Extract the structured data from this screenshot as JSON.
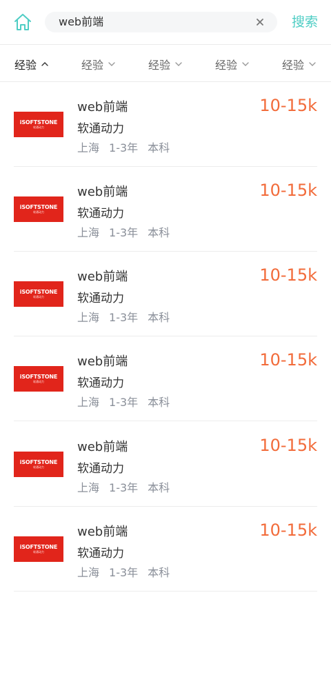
{
  "header": {
    "search_value": "web前端",
    "search_button": "搜索"
  },
  "filters": [
    {
      "label": "经验",
      "active": true
    },
    {
      "label": "经验",
      "active": false
    },
    {
      "label": "经验",
      "active": false
    },
    {
      "label": "经验",
      "active": false
    },
    {
      "label": "经验",
      "active": false
    }
  ],
  "jobs": [
    {
      "title": "web前端",
      "company": "软通动力",
      "city": "上海",
      "experience": "1-3年",
      "education": "本科",
      "salary": "10-15k",
      "logo_text": "iSOFTSTONE",
      "logo_sub": "软通动力"
    },
    {
      "title": "web前端",
      "company": "软通动力",
      "city": "上海",
      "experience": "1-3年",
      "education": "本科",
      "salary": "10-15k",
      "logo_text": "iSOFTSTONE",
      "logo_sub": "软通动力"
    },
    {
      "title": "web前端",
      "company": "软通动力",
      "city": "上海",
      "experience": "1-3年",
      "education": "本科",
      "salary": "10-15k",
      "logo_text": "iSOFTSTONE",
      "logo_sub": "软通动力"
    },
    {
      "title": "web前端",
      "company": "软通动力",
      "city": "上海",
      "experience": "1-3年",
      "education": "本科",
      "salary": "10-15k",
      "logo_text": "iSOFTSTONE",
      "logo_sub": "软通动力"
    },
    {
      "title": "web前端",
      "company": "软通动力",
      "city": "上海",
      "experience": "1-3年",
      "education": "本科",
      "salary": "10-15k",
      "logo_text": "iSOFTSTONE",
      "logo_sub": "软通动力"
    },
    {
      "title": "web前端",
      "company": "软通动力",
      "city": "上海",
      "experience": "1-3年",
      "education": "本科",
      "salary": "10-15k",
      "logo_text": "iSOFTSTONE",
      "logo_sub": "软通动力"
    }
  ],
  "colors": {
    "accent": "#4ecdc4",
    "salary": "#f26b3a",
    "logo_bg": "#e1251b"
  },
  "icons": {
    "home": "home-icon",
    "clear": "close-icon",
    "filter_open": "chevron-up-icon",
    "filter_closed": "chevron-down-icon"
  }
}
